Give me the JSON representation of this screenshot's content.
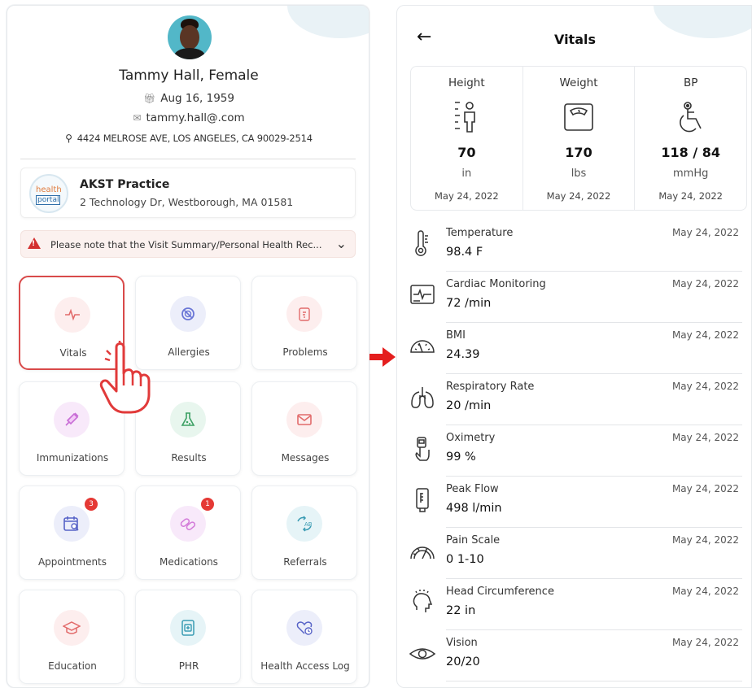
{
  "left": {
    "patient": {
      "name": "Tammy Hall, Female",
      "dob": "Aug 16, 1959",
      "email": "tammy.hall@.com",
      "address": "4424 MELROSE AVE, LOS ANGELES, CA 90029-2514"
    },
    "practice": {
      "logo_text_1": "health",
      "logo_text_2": "portal",
      "name": "AKST Practice",
      "address": "2 Technology Dr, Westborough, MA 01581"
    },
    "notice": "Please note that the Visit Summary/Personal Health Rec...",
    "tiles": [
      {
        "label": "Vitals",
        "icon": "heartbeat-icon",
        "color": "#fdeeee",
        "badge": ""
      },
      {
        "label": "Allergies",
        "icon": "allergy-icon",
        "color": "#eceefa",
        "badge": ""
      },
      {
        "label": "Problems",
        "icon": "clipboard-icon",
        "color": "#fdeeee",
        "badge": ""
      },
      {
        "label": "Immunizations",
        "icon": "syringe-icon",
        "color": "#f8e9fa",
        "badge": ""
      },
      {
        "label": "Results",
        "icon": "flask-icon",
        "color": "#e8f6ee",
        "badge": ""
      },
      {
        "label": "Messages",
        "icon": "envelope-icon",
        "color": "#fdeeee",
        "badge": ""
      },
      {
        "label": "Appointments",
        "icon": "calendar-icon",
        "color": "#eceefa",
        "badge": "3"
      },
      {
        "label": "Medications",
        "icon": "pill-icon",
        "color": "#f8e9fa",
        "badge": "1"
      },
      {
        "label": "Referrals",
        "icon": "referral-icon",
        "color": "#e6f4f7",
        "badge": ""
      },
      {
        "label": "Education",
        "icon": "graduation-cap-icon",
        "color": "#fdeeee",
        "badge": ""
      },
      {
        "label": "PHR",
        "icon": "record-icon",
        "color": "#e6f4f7",
        "badge": ""
      },
      {
        "label": "Health Access Log",
        "icon": "access-log-icon",
        "color": "#eceefa",
        "badge": ""
      }
    ]
  },
  "right": {
    "title": "Vitals",
    "back_icon": "←",
    "summary": [
      {
        "label": "Height",
        "value": "70",
        "unit": "in",
        "date": "May 24, 2022"
      },
      {
        "label": "Weight",
        "value": "170",
        "unit": "lbs",
        "date": "May 24, 2022"
      },
      {
        "label": "BP",
        "value": "118 / 84",
        "unit": "mmHg",
        "date": "May 24, 2022"
      }
    ],
    "vitals": [
      {
        "name": "Temperature",
        "value": "98.4 F",
        "date": "May 24, 2022"
      },
      {
        "name": "Cardiac Monitoring",
        "value": "72 /min",
        "date": "May 24, 2022"
      },
      {
        "name": "BMI",
        "value": "24.39",
        "date": "May 24, 2022"
      },
      {
        "name": "Respiratory Rate",
        "value": "20 /min",
        "date": "May 24, 2022"
      },
      {
        "name": "Oximetry",
        "value": "99 %",
        "date": "May 24, 2022"
      },
      {
        "name": "Peak Flow",
        "value": "498 l/min",
        "date": "May 24, 2022"
      },
      {
        "name": "Pain Scale",
        "value": "0 1-10",
        "date": "May 24, 2022"
      },
      {
        "name": "Head Circumference",
        "value": "22 in",
        "date": "May 24, 2022"
      },
      {
        "name": "Vision",
        "value": "20/20",
        "date": "May 24, 2022"
      }
    ]
  },
  "colors": {
    "accent_red": "#d94a4a",
    "badge_red": "#e53935",
    "notice_bg": "#fbf1ef"
  }
}
